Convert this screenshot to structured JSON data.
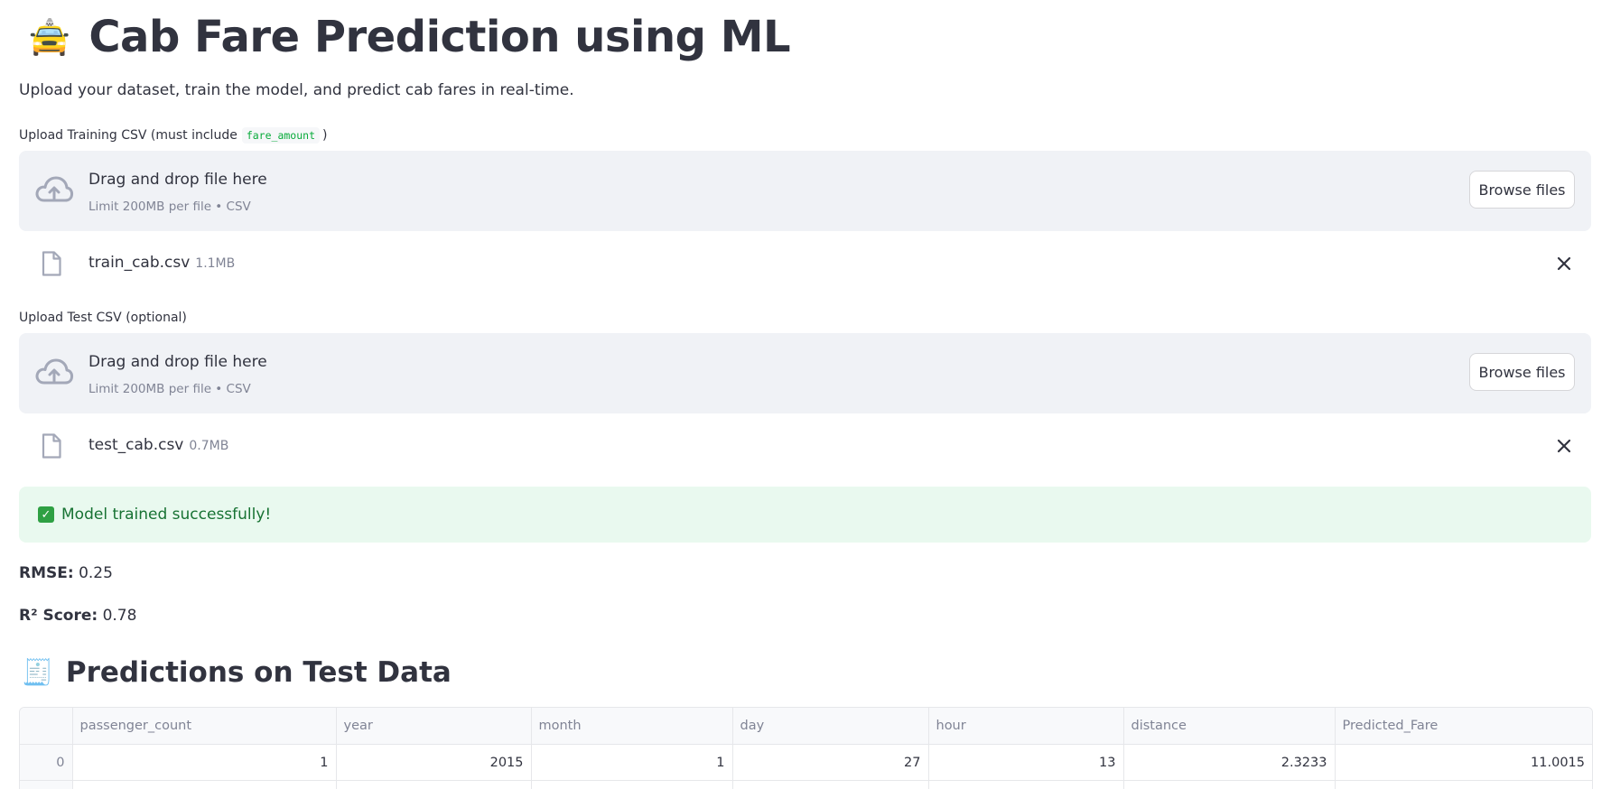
{
  "header": {
    "emoji": "🚖",
    "title": "Cab Fare Prediction using ML",
    "subtitle": "Upload your dataset, train the model, and predict cab fares in real-time."
  },
  "train_upload": {
    "label_prefix": "Upload Training CSV (must include",
    "label_code": "fare_amount",
    "label_suffix": ")",
    "drop_title": "Drag and drop file here",
    "drop_limit": "Limit 200MB per file • CSV",
    "browse_label": "Browse files",
    "file_name": "train_cab.csv",
    "file_size": "1.1MB"
  },
  "test_upload": {
    "label": "Upload Test CSV (optional)",
    "drop_title": "Drag and drop file here",
    "drop_limit": "Limit 200MB per file • CSV",
    "browse_label": "Browse files",
    "file_name": "test_cab.csv",
    "file_size": "0.7MB"
  },
  "status": {
    "check_glyph": "✓",
    "message": "Model trained successfully!",
    "color": "#177233",
    "background": "#e9f9ef"
  },
  "metrics": {
    "rmse_label": "RMSE:",
    "rmse_value": "0.25",
    "r2_label": "R² Score:",
    "r2_value": "0.78"
  },
  "predictions": {
    "emoji": "🧾",
    "title": "Predictions on Test Data",
    "columns": [
      "",
      "passenger_count",
      "year",
      "month",
      "day",
      "hour",
      "distance",
      "Predicted_Fare"
    ],
    "rows": [
      [
        "0",
        "1",
        "2015",
        "1",
        "27",
        "13",
        "2.3233",
        "11.0015"
      ],
      [
        "",
        "",
        "",
        "",
        "",
        "",
        "",
        ""
      ]
    ]
  },
  "icons": {
    "upload": "cloud-upload-icon",
    "file": "file-icon",
    "close": "close-icon",
    "check": "check-icon"
  }
}
